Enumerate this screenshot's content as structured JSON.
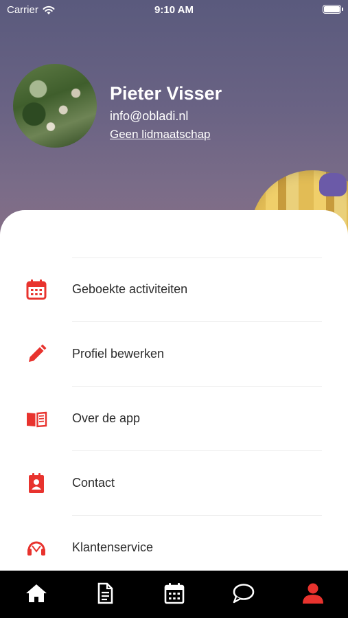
{
  "status_bar": {
    "carrier": "Carrier",
    "time": "9:10 AM"
  },
  "profile": {
    "name": "Pieter Visser",
    "email": "info@obladi.nl",
    "membership": "Geen lidmaatschap"
  },
  "menu": {
    "items": [
      {
        "label": "Geboekte activiteiten",
        "icon": "calendar-icon"
      },
      {
        "label": "Profiel bewerken",
        "icon": "pencil-icon"
      },
      {
        "label": "Over de app",
        "icon": "book-icon"
      },
      {
        "label": "Contact",
        "icon": "contact-card-icon"
      },
      {
        "label": "Klantenservice",
        "icon": "headset-icon"
      }
    ]
  },
  "tabbar": {
    "tabs": [
      {
        "name": "home",
        "icon": "home-icon",
        "active": false
      },
      {
        "name": "documents",
        "icon": "document-icon",
        "active": false
      },
      {
        "name": "calendar",
        "icon": "calendar-icon",
        "active": false
      },
      {
        "name": "messages",
        "icon": "chat-icon",
        "active": false
      },
      {
        "name": "profile",
        "icon": "user-icon",
        "active": true
      }
    ]
  },
  "colors": {
    "accent": "#e8332e",
    "tabbar_bg": "#000000",
    "tab_icon": "#ffffff"
  }
}
